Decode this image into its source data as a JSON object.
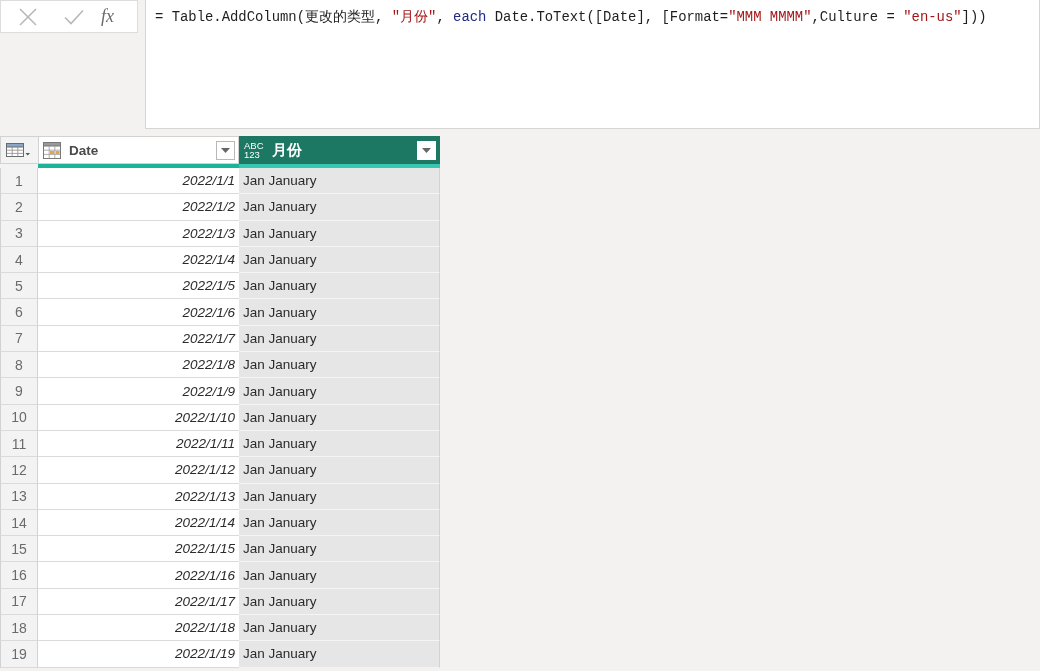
{
  "formula_bar": {
    "buttons": [
      {
        "kind": "cancel",
        "disabled": true
      },
      {
        "kind": "commit",
        "disabled": true
      }
    ],
    "fx_label": "fx",
    "formula": [
      {
        "text": "= Table.AddColumn(更改的类型, ",
        "kind": "plain"
      },
      {
        "text": "\"月份\"",
        "kind": "string"
      },
      {
        "text": ", ",
        "kind": "plain"
      },
      {
        "text": "each",
        "kind": "keyword"
      },
      {
        "text": " Date.ToText([Date], [Format=",
        "kind": "plain"
      },
      {
        "text": "\"MMM MMMM\"",
        "kind": "string"
      },
      {
        "text": ",Culture = ",
        "kind": "plain"
      },
      {
        "text": "\"en-us\"",
        "kind": "string"
      },
      {
        "text": "]))",
        "kind": "plain"
      }
    ]
  },
  "table": {
    "columns": [
      {
        "label": "Date",
        "kind": "date",
        "selected": false,
        "level": 1
      },
      {
        "label": "月份",
        "kind": "any",
        "type_label": "ABC 123",
        "selected": true,
        "level": 1
      }
    ],
    "rows": [
      {
        "index": "1",
        "cells": [
          "2022/1/1",
          "Jan January"
        ]
      },
      {
        "index": "2",
        "cells": [
          "2022/1/2",
          "Jan January"
        ]
      },
      {
        "index": "3",
        "cells": [
          "2022/1/3",
          "Jan January"
        ]
      },
      {
        "index": "4",
        "cells": [
          "2022/1/4",
          "Jan January"
        ]
      },
      {
        "index": "5",
        "cells": [
          "2022/1/5",
          "Jan January"
        ]
      },
      {
        "index": "6",
        "cells": [
          "2022/1/6",
          "Jan January"
        ]
      },
      {
        "index": "7",
        "cells": [
          "2022/1/7",
          "Jan January"
        ]
      },
      {
        "index": "8",
        "cells": [
          "2022/1/8",
          "Jan January"
        ]
      },
      {
        "index": "9",
        "cells": [
          "2022/1/9",
          "Jan January"
        ]
      },
      {
        "index": "10",
        "cells": [
          "2022/1/10",
          "Jan January"
        ]
      },
      {
        "index": "11",
        "cells": [
          "2022/1/11",
          "Jan January"
        ]
      },
      {
        "index": "12",
        "cells": [
          "2022/1/12",
          "Jan January"
        ]
      },
      {
        "index": "13",
        "cells": [
          "2022/1/13",
          "Jan January"
        ]
      },
      {
        "index": "14",
        "cells": [
          "2022/1/14",
          "Jan January"
        ]
      },
      {
        "index": "15",
        "cells": [
          "2022/1/15",
          "Jan January"
        ]
      },
      {
        "index": "16",
        "cells": [
          "2022/1/16",
          "Jan January"
        ]
      },
      {
        "index": "17",
        "cells": [
          "2022/1/17",
          "Jan January"
        ]
      },
      {
        "index": "18",
        "cells": [
          "2022/1/18",
          "Jan January"
        ]
      },
      {
        "index": "19",
        "cells": [
          "2022/1/19",
          "Jan January"
        ]
      }
    ]
  }
}
